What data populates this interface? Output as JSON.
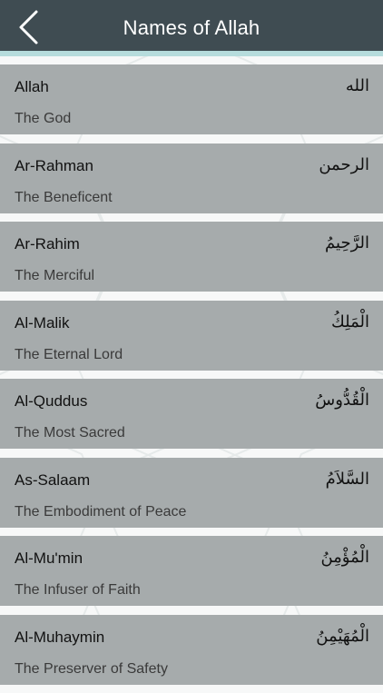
{
  "header": {
    "title": "Names of Allah",
    "back_icon": "chevron-left-icon"
  },
  "colors": {
    "navbar": "#3f4c52",
    "accent": "#b6dcdc",
    "row": "#a6abac",
    "background": "#f7f8f8"
  },
  "names": [
    {
      "transliteration": "Allah",
      "meaning": "The God",
      "arabic": "الله"
    },
    {
      "transliteration": "Ar-Rahman",
      "meaning": "The Beneficent",
      "arabic": "الرحمن"
    },
    {
      "transliteration": "Ar-Rahim",
      "meaning": "The Merciful",
      "arabic": "الرَّحِيمُ"
    },
    {
      "transliteration": "Al-Malik",
      "meaning": "The Eternal Lord",
      "arabic": "الْمَلِكُ"
    },
    {
      "transliteration": "Al-Quddus",
      "meaning": "The Most Sacred",
      "arabic": "الْقُدُّوسُ"
    },
    {
      "transliteration": "As-Salaam",
      "meaning": "The Embodiment of Peace",
      "arabic": "السَّلاَمُ"
    },
    {
      "transliteration": "Al-Mu'min",
      "meaning": "The Infuser of Faith",
      "arabic": "الْمُؤْمِنُ"
    },
    {
      "transliteration": "Al-Muhaymin",
      "meaning": "The Preserver of Safety",
      "arabic": "الْمُهَيْمِنُ"
    }
  ]
}
